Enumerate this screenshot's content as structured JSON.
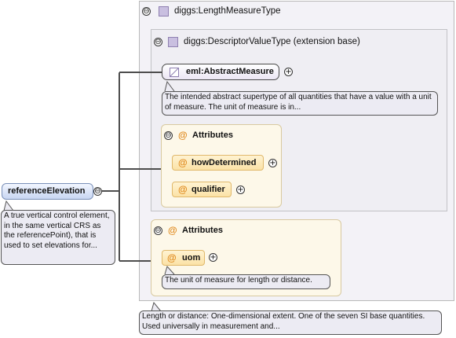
{
  "root": {
    "label": "referenceElevation",
    "toggle": "⊖",
    "doc": "A true vertical control element, in the same vertical CRS as the referencePoint), that is used to set elevations for..."
  },
  "type_box": {
    "toggle": "⊖",
    "title": "diggs:LengthMeasureType",
    "doc": "Length or distance: One-dimensional extent. One of the seven SI base quantities. Used universally in measurement and..."
  },
  "base_box": {
    "toggle": "⊖",
    "title": "diggs:DescriptorValueType (extension base)"
  },
  "abstract_measure": {
    "label": "eml:AbstractMeasure",
    "doc": "The intended abstract supertype of all quantities that have a value with a unit of measure. The unit of measure is in..."
  },
  "base_attributes": {
    "toggle": "⊖",
    "at": "@",
    "title": "Attributes",
    "items": [
      {
        "label": "howDetermined"
      },
      {
        "label": "qualifier"
      }
    ]
  },
  "type_attributes": {
    "toggle": "⊖",
    "at": "@",
    "title": "Attributes",
    "items": [
      {
        "label": "uom",
        "doc": "The unit of measure for length or distance."
      }
    ]
  },
  "colors": {
    "connector": "#4d4d4d",
    "type_box_bg": "#f3f2f7",
    "attribute_fill": "#fbe2a6",
    "attribute_at": "#e08a1e",
    "root_fill": "#c8d6f2"
  },
  "icons": {
    "toggle": "minus-circle-icon",
    "expand": "plus-circle-icon",
    "type": "complex-type-square-icon",
    "abstract": "abstract-element-icon",
    "attribute": "at-icon"
  }
}
